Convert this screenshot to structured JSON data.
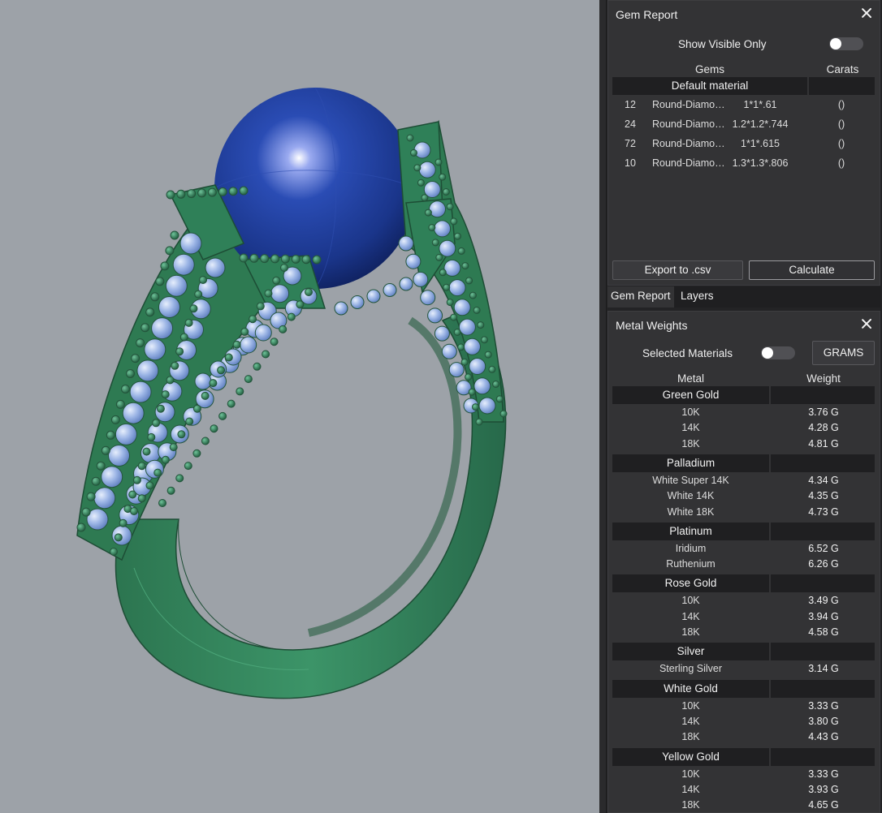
{
  "gem_report": {
    "title": "Gem Report",
    "show_visible_only_label": "Show Visible Only",
    "show_visible_only": false,
    "columns": {
      "gems": "Gems",
      "carats": "Carats"
    },
    "group_name": "Default material",
    "rows": [
      {
        "count": "12",
        "shape": "Round-Diamo…",
        "size": "1*1*.61",
        "carats": "()"
      },
      {
        "count": "24",
        "shape": "Round-Diamo…",
        "size": "1.2*1.2*.744",
        "carats": "()"
      },
      {
        "count": "72",
        "shape": "Round-Diamo…",
        "size": "1*1*.615",
        "carats": "()"
      },
      {
        "count": "10",
        "shape": "Round-Diamo…",
        "size": "1.3*1.3*.806",
        "carats": "()"
      }
    ],
    "export_label": "Export to .csv",
    "calculate_label": "Calculate"
  },
  "tabs": [
    "Gem Report",
    "Layers"
  ],
  "metal_weights": {
    "title": "Metal Weights",
    "selected_materials_label": "Selected Materials",
    "selected_materials": false,
    "unit_button": "GRAMS",
    "columns": {
      "metal": "Metal",
      "weight": "Weight"
    },
    "groups": [
      {
        "name": "Green Gold",
        "items": [
          {
            "name": "10K",
            "weight": "3.76 G"
          },
          {
            "name": "14K",
            "weight": "4.28 G"
          },
          {
            "name": "18K",
            "weight": "4.81 G"
          }
        ]
      },
      {
        "name": "Palladium",
        "items": [
          {
            "name": "White Super 14K",
            "weight": "4.34 G"
          },
          {
            "name": "White 14K",
            "weight": "4.35 G"
          },
          {
            "name": "White 18K",
            "weight": "4.73 G"
          }
        ]
      },
      {
        "name": "Platinum",
        "items": [
          {
            "name": "Iridium",
            "weight": "6.52 G"
          },
          {
            "name": "Ruthenium",
            "weight": "6.26 G"
          }
        ]
      },
      {
        "name": "Rose Gold",
        "items": [
          {
            "name": "10K",
            "weight": "3.49 G"
          },
          {
            "name": "14K",
            "weight": "3.94 G"
          },
          {
            "name": "18K",
            "weight": "4.58 G"
          }
        ]
      },
      {
        "name": "Silver",
        "items": [
          {
            "name": "Sterling Silver",
            "weight": "3.14 G"
          }
        ]
      },
      {
        "name": "White Gold",
        "items": [
          {
            "name": "10K",
            "weight": "3.33 G"
          },
          {
            "name": "14K",
            "weight": "3.80 G"
          },
          {
            "name": "18K",
            "weight": "4.43 G"
          }
        ]
      },
      {
        "name": "Yellow Gold",
        "items": [
          {
            "name": "10K",
            "weight": "3.33 G"
          },
          {
            "name": "14K",
            "weight": "3.93 G"
          },
          {
            "name": "18K",
            "weight": "4.65 G"
          }
        ]
      }
    ]
  },
  "colors": {
    "viewport_bg": "#9da2a8",
    "metal_green": "#2f7a52",
    "pearl_blue": "#1d3e9e",
    "stone_blue": "#9fb8e8",
    "panel_bg": "#333335",
    "group_bar": "#1f1f21"
  }
}
